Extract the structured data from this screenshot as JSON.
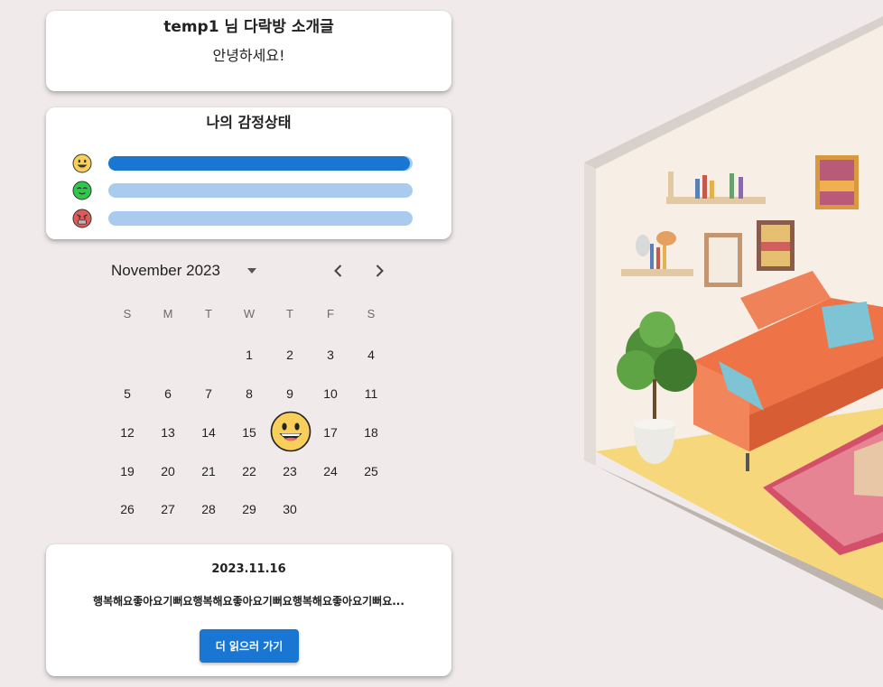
{
  "intro": {
    "title": "temp1 님 다락방 소개글",
    "text": "안녕하세요!"
  },
  "emotions": {
    "title": "나의 감정상태",
    "items": [
      {
        "icon": "happy-face-icon",
        "color": "#f7cf5a",
        "level": 0.99,
        "fill_color": "#1976d2"
      },
      {
        "icon": "calm-green-face-icon",
        "color": "#2ec84a",
        "level": 0.0,
        "fill_color": "#1976d2"
      },
      {
        "icon": "angry-red-face-icon",
        "color": "#e05a5a",
        "level": 0.0,
        "fill_color": "#1976d2"
      }
    ],
    "track_color": "#a8cbee"
  },
  "calendar": {
    "month_label": "November 2023",
    "weekdays": [
      "S",
      "M",
      "T",
      "W",
      "T",
      "F",
      "S"
    ],
    "weeks": [
      [
        "",
        "",
        "",
        "1",
        "2",
        "3",
        "4"
      ],
      [
        "5",
        "6",
        "7",
        "8",
        "9",
        "10",
        "11"
      ],
      [
        "12",
        "13",
        "14",
        "15",
        "16",
        "17",
        "18"
      ],
      [
        "19",
        "20",
        "21",
        "22",
        "23",
        "24",
        "25"
      ],
      [
        "26",
        "27",
        "28",
        "29",
        "30",
        "",
        ""
      ]
    ],
    "emoji_day": {
      "day": "16",
      "icon": "happy-face-icon"
    },
    "icons": {
      "dropdown": "caret-down-icon",
      "prev": "chevron-left-icon",
      "next": "chevron-right-icon"
    }
  },
  "diary": {
    "date": "2023.11.16",
    "excerpt": "행복해요좋아요기뻐요행복해요좋아요기뻐요행복해요좋아요기뻐요...",
    "button_label": "더 읽으러 가기"
  },
  "illustration": {
    "icon": "isometric-living-room-illustration"
  },
  "colors": {
    "background": "#f0eaea",
    "accent": "#1976d2",
    "card": "#ffffff"
  }
}
